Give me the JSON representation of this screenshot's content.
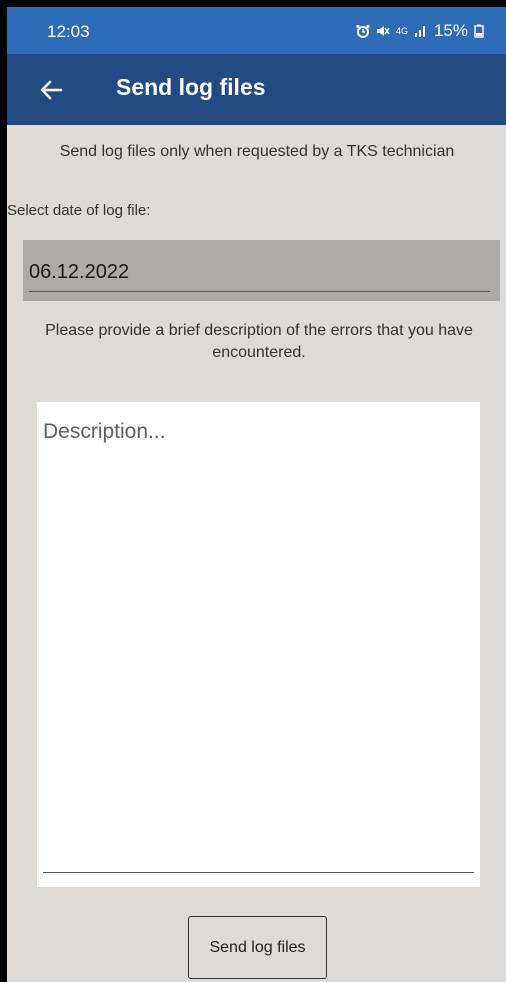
{
  "status_bar": {
    "time": "12:03",
    "network": "4G",
    "battery": "15%"
  },
  "app_bar": {
    "back_icon": "arrow-left-icon",
    "title": "Send log files"
  },
  "notice": "Send log files only when requested by a TKS technician",
  "date_section": {
    "label": "Select date of log file:",
    "value": "06.12.2022"
  },
  "description_section": {
    "label": "Please provide a brief description of the errors that you have encountered.",
    "placeholder": "Description...",
    "value": ""
  },
  "send_button_label": "Send log files",
  "colors": {
    "status_bar": "#2f6cb8",
    "app_bar": "#224a83",
    "background": "#dedad5",
    "date_field": "#aeaba6"
  }
}
